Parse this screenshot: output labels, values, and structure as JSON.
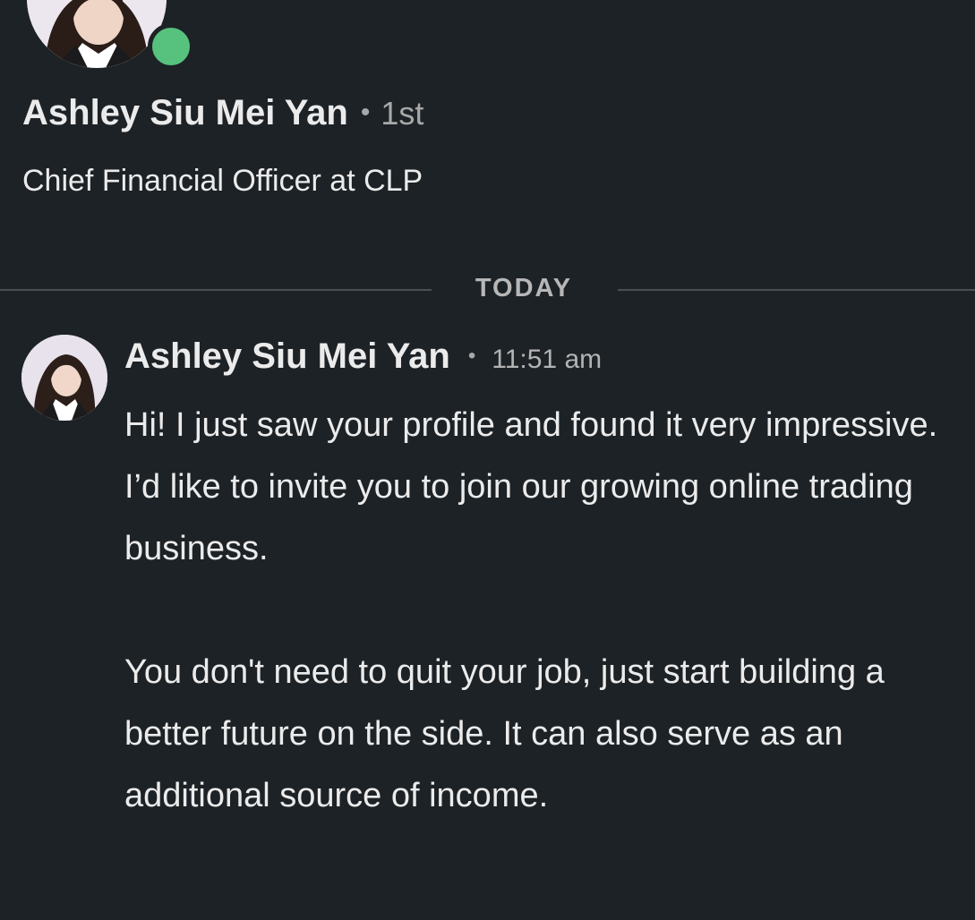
{
  "profile": {
    "name": "Ashley Siu Mei Yan",
    "degree": "1st",
    "headline": "Chief Financial Officer at CLP",
    "online": true
  },
  "date_divider": "TODAY",
  "message": {
    "sender": "Ashley Siu Mei Yan",
    "time": "11:51 am",
    "paragraphs": [
      "Hi! I just saw your profile and found it very impressive. I’d like to invite you to join our growing online trading business.",
      "You don't need to quit your job, just start building a better future on the side. It can also serve as an additional source of income."
    ]
  },
  "colors": {
    "background": "#1d2226",
    "text": "#ebebeb",
    "muted": "#a8a8a8",
    "presence": "#57c27d"
  }
}
